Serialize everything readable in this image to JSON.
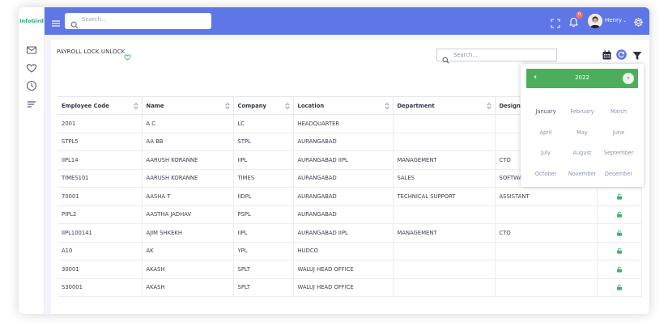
{
  "app": {
    "logo_text": "InfoGird"
  },
  "topbar": {
    "search_placeholder": "Search...",
    "notification_count": "0",
    "user_name": "Henry"
  },
  "page": {
    "title": "PAYROLL LOCK UNLOCK",
    "search_placeholder": "Search..."
  },
  "table": {
    "headers": [
      "Employee Code",
      "Name",
      "Company",
      "Location",
      "Department",
      "Designa"
    ],
    "rows": [
      {
        "code": "2001",
        "name": "A C",
        "company": "LC",
        "location": "HEADQUARTER",
        "department": "",
        "designation": "",
        "locked": false
      },
      {
        "code": "STPL5",
        "name": "AA BB",
        "company": "STPL",
        "location": "AURANGABAD",
        "department": "",
        "designation": "",
        "locked": false
      },
      {
        "code": "IIPL14",
        "name": "AARUSH KORANNE",
        "company": "IIPL",
        "location": "AURANGABAD IIPL",
        "department": "MANAGEMENT",
        "designation": "CTO",
        "locked": false
      },
      {
        "code": "TIMES101",
        "name": "AARUSH KORANNE",
        "company": "TIMES",
        "location": "AURANGABAD",
        "department": "SALES",
        "designation": "SOFTWA",
        "locked": false
      },
      {
        "code": "70001",
        "name": "AASHA T",
        "company": "IIDPL",
        "location": "AURANGABAD",
        "department": "TECHNICAL SUPPORT",
        "designation": "ASSISTANT",
        "locked": true
      },
      {
        "code": "PIPL2",
        "name": "AASTHA JADHAV",
        "company": "PSPL",
        "location": "AURANGABAD",
        "department": "",
        "designation": "",
        "locked": true
      },
      {
        "code": "IIPL100141",
        "name": "AJIM SHKEKH",
        "company": "IIPL",
        "location": "AURANGABAD IIPL",
        "department": "MANAGEMENT",
        "designation": "CTO",
        "locked": true
      },
      {
        "code": "A10",
        "name": "AK",
        "company": "YPL",
        "location": "HUDCO",
        "department": "",
        "designation": "",
        "locked": true
      },
      {
        "code": "30001",
        "name": "AKASH",
        "company": "SPLT",
        "location": "WALUJ HEAD OFFICE",
        "department": "",
        "designation": "",
        "locked": true
      },
      {
        "code": "S30001",
        "name": "AKASH",
        "company": "SPLT",
        "location": "WALUJ HEAD OFFICE",
        "department": "",
        "designation": "",
        "locked": true
      }
    ]
  },
  "calendar": {
    "year": "2022",
    "prev_symbol": "‹",
    "next_symbol": "›",
    "months": [
      "January",
      "February",
      "March",
      "April",
      "May",
      "June",
      "July",
      "August",
      "September",
      "October",
      "November",
      "December"
    ],
    "selected_month": "January"
  },
  "colors": {
    "topbar": "#5e76e6",
    "accent_green": "#4cae5c",
    "lock_green": "#3db36a",
    "badge": "#f0716e"
  },
  "icons": {
    "sidebar": [
      "mail-icon",
      "heart-icon",
      "clock-icon",
      "list-icon"
    ],
    "toolbar": [
      "calendar-icon",
      "refresh-icon",
      "filter-icon"
    ]
  }
}
